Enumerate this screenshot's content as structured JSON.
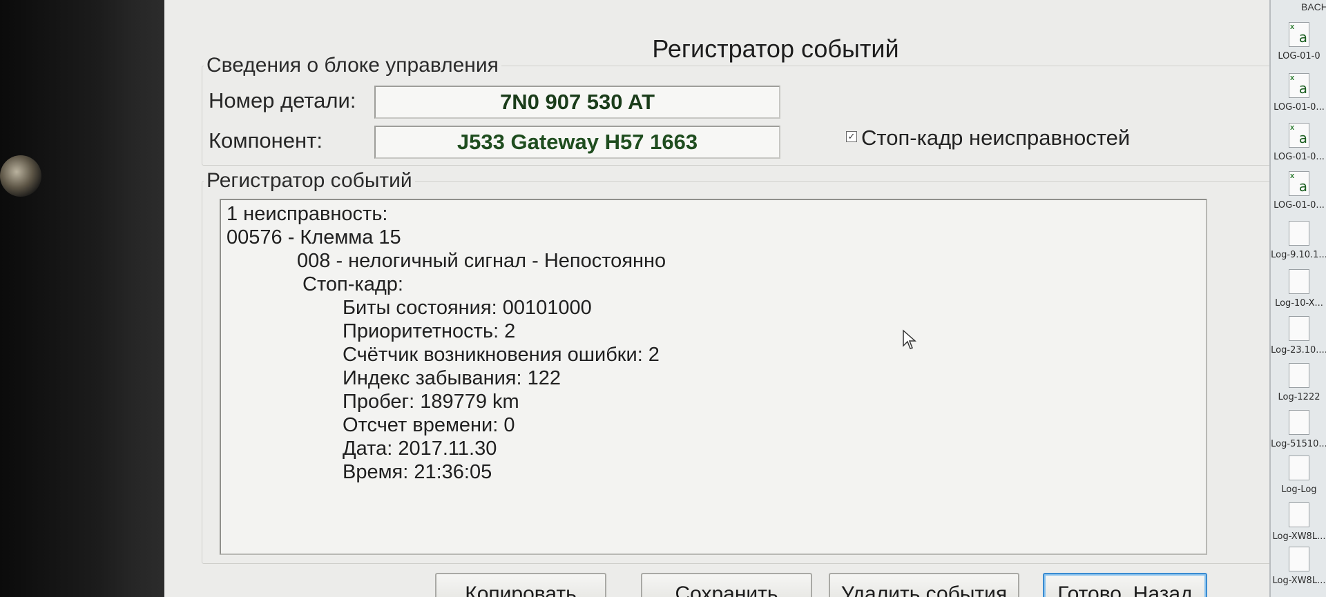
{
  "window": {
    "title": "Регистратор событий"
  },
  "control_unit": {
    "legend": "Сведения о блоке управления",
    "part_number_label": "Номер детали:",
    "part_number_value": "7N0 907 530 AT",
    "component_label": "Компонент:",
    "component_value": "J533  Gateway H57 1663",
    "freeze_frame_checkbox_label": "Стоп-кадр неисправностей",
    "freeze_frame_checked": true
  },
  "event_log": {
    "legend": "Регистратор событий",
    "lines": [
      "1 неисправность:",
      "00576 - Клемма 15",
      "008 - нелогичный сигнал - Непостоянно",
      "Стоп-кадр:",
      "Биты состояния: 00101000",
      "Приоритетность: 2",
      "Счётчик возникновения ошибки: 2",
      "Индекс забывания: 122",
      "Пробег: 189779 km",
      "Отсчет времени: 0",
      "Дата: 2017.11.30",
      "Время: 21:36:05"
    ]
  },
  "buttons": {
    "copy": "Копировать",
    "save": "Сохранить",
    "delete_events": "Удалить события",
    "done_back": "Готово, Назад"
  },
  "desktop": {
    "top_label": "BACH",
    "icons": [
      {
        "name": "LOG-01-0",
        "type": "excel-icon"
      },
      {
        "name": "LOG-01-0...",
        "type": "excel-icon"
      },
      {
        "name": "LOG-01-0...",
        "type": "excel-icon"
      },
      {
        "name": "LOG-01-0...",
        "type": "excel-icon"
      },
      {
        "name": "Log-9.10.1...",
        "type": "text-file-icon"
      },
      {
        "name": "Log-10-X...",
        "type": "text-file-icon"
      },
      {
        "name": "Log-23.10....",
        "type": "text-file-icon"
      },
      {
        "name": "Log-1222",
        "type": "text-file-icon"
      },
      {
        "name": "Log-51510...",
        "type": "text-file-icon"
      },
      {
        "name": "Log-Log",
        "type": "text-file-icon"
      },
      {
        "name": "Log-XW8L...",
        "type": "text-file-icon"
      },
      {
        "name": "Log-XW8L...",
        "type": "text-file-icon"
      }
    ]
  }
}
